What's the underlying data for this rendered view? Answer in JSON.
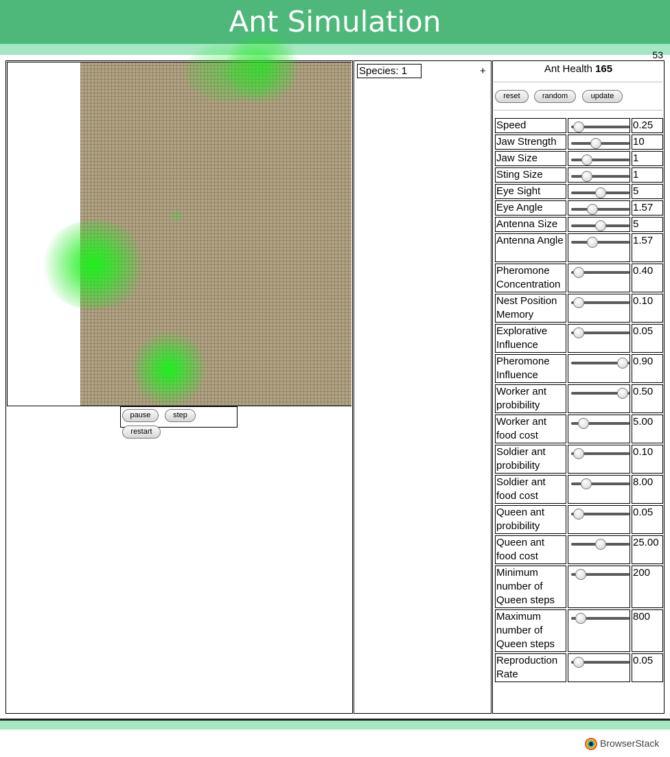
{
  "header": {
    "title": "Ant Simulation"
  },
  "fps": "53",
  "controls": {
    "pause": "pause",
    "step": "step",
    "restart": "restart"
  },
  "species": {
    "selected": "Species: 1",
    "add": "+"
  },
  "ant_health": {
    "label": "Ant Health",
    "value": "165"
  },
  "actions": {
    "reset": "reset",
    "random": "random",
    "update": "update"
  },
  "parameters": [
    {
      "label": "Speed",
      "value": "0.25",
      "slider": 0.05
    },
    {
      "label": "Jaw Strength",
      "value": "10",
      "slider": 0.4
    },
    {
      "label": "Jaw Size",
      "value": "1",
      "slider": 0.22
    },
    {
      "label": "Sting Size",
      "value": "1",
      "slider": 0.22
    },
    {
      "label": "Eye Sight",
      "value": "5",
      "slider": 0.5
    },
    {
      "label": "Eye Angle",
      "value": "1.57",
      "slider": 0.33
    },
    {
      "label": "Antenna Size",
      "value": "5",
      "slider": 0.5
    },
    {
      "label": "Antenna Angle",
      "value": "1.57",
      "slider": 0.33
    },
    {
      "label": "Pheromone Concentration",
      "value": "0.40",
      "slider": 0.05
    },
    {
      "label": "Nest Position Memory",
      "value": "0.10",
      "slider": 0.05
    },
    {
      "label": "Explorative Influence",
      "value": "0.05",
      "slider": 0.05
    },
    {
      "label": "Pheromone Influence",
      "value": "0.90",
      "slider": 0.97
    },
    {
      "label": "Worker ant probibility",
      "value": "0.50",
      "slider": 0.97
    },
    {
      "label": "Worker ant food cost",
      "value": "5.00",
      "slider": 0.15
    },
    {
      "label": "Soldier ant probibility",
      "value": "0.10",
      "slider": 0.05
    },
    {
      "label": "Soldier ant food cost",
      "value": "8.00",
      "slider": 0.2
    },
    {
      "label": "Queen ant probibility",
      "value": "0.05",
      "slider": 0.05
    },
    {
      "label": "Queen ant food cost",
      "value": "25.00",
      "slider": 0.5
    },
    {
      "label": "Minimum number of Queen steps",
      "value": "200",
      "slider": 0.08
    },
    {
      "label": "Maximum number of Queen steps",
      "value": "800",
      "slider": 0.08
    },
    {
      "label": "Reproduction Rate",
      "value": "0.05",
      "slider": 0.05
    }
  ],
  "footer": {
    "brand": "BrowserStack"
  },
  "colors": {
    "header": "#4db87a",
    "header_strip": "#a3e8c0",
    "soil": "#b3a282",
    "food": "#1ee61e"
  }
}
